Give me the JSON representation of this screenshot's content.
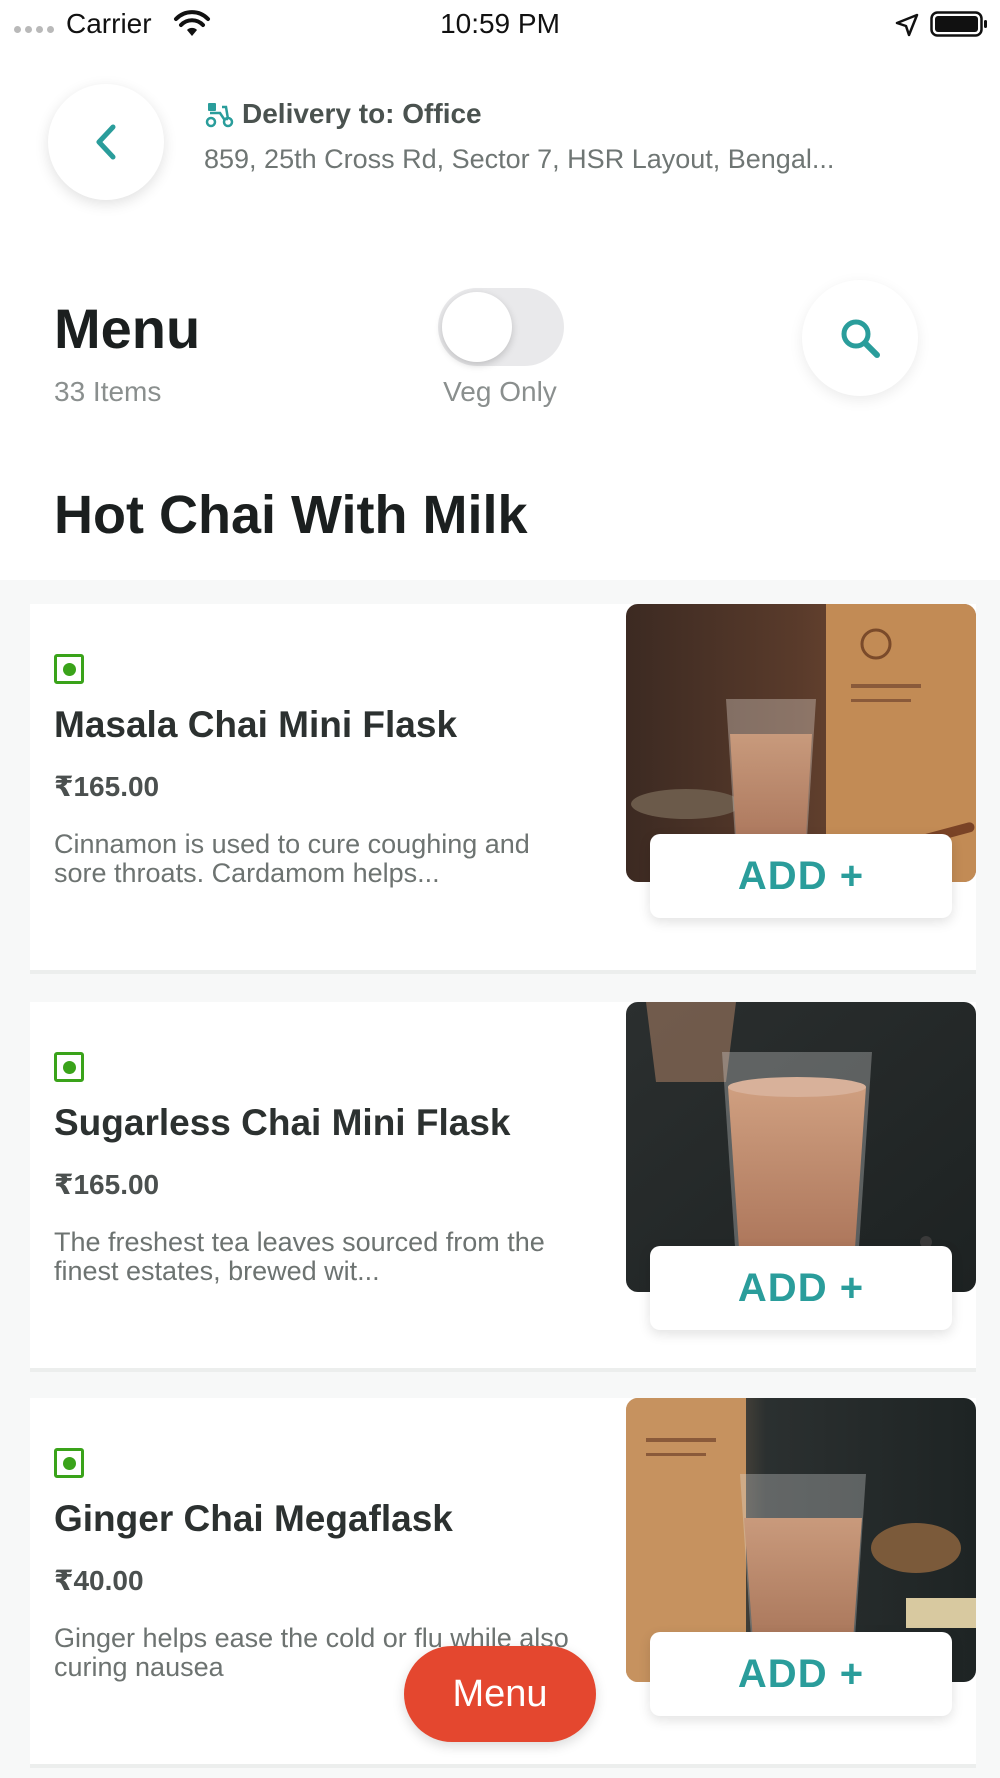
{
  "status_bar": {
    "carrier": "Carrier",
    "time": "10:59 PM"
  },
  "header": {
    "back_icon": "chevron-left-icon",
    "delivery_icon": "scooter-icon",
    "delivery_label": "Delivery to: Office",
    "address": "859, 25th Cross Rd, Sector 7, HSR Layout, Bengal..."
  },
  "menu": {
    "title": "Menu",
    "count": "33 Items",
    "veg_only_label": "Veg Only",
    "veg_only_enabled": false,
    "search_icon": "search-icon"
  },
  "section": {
    "title": "Hot Chai With Milk"
  },
  "items": [
    {
      "name": "Masala Chai Mini Flask",
      "price": "₹165.00",
      "description": "Cinnamon is used to cure coughing and sore throats. Cardamom helps...",
      "add_label": "ADD +",
      "veg": true
    },
    {
      "name": "Sugarless Chai Mini Flask",
      "price": "₹165.00",
      "description": "The freshest tea leaves sourced from the finest estates, brewed wit...",
      "add_label": "ADD +",
      "veg": true
    },
    {
      "name": "Ginger Chai Megaflask",
      "price": "₹40.00",
      "description": "Ginger helps ease the cold or flu while also curing nausea",
      "add_label": "ADD +",
      "veg": true
    }
  ],
  "fab": {
    "label": "Menu"
  },
  "colors": {
    "accent": "#2a9d9b",
    "veg_green": "#3aa31a",
    "fab_red": "#e4472f"
  }
}
